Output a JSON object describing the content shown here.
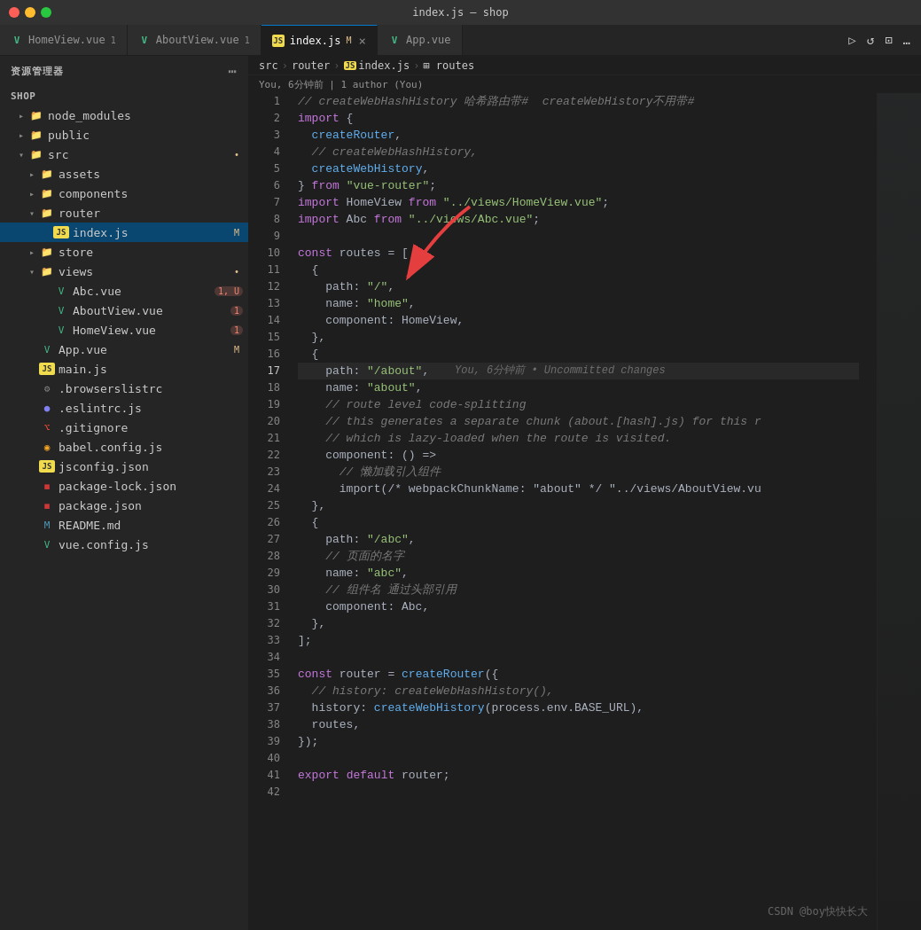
{
  "window": {
    "title": "index.js — shop"
  },
  "tabs": [
    {
      "id": "homeview",
      "label": "HomeView.vue",
      "icon": "vue",
      "badge": "1",
      "active": false
    },
    {
      "id": "aboutview",
      "label": "AboutView.vue",
      "icon": "vue",
      "badge": "1",
      "active": false
    },
    {
      "id": "indexjs",
      "label": "index.js",
      "icon": "js",
      "badge": "M",
      "active": true,
      "modified": true
    },
    {
      "id": "appvue",
      "label": "App.vue",
      "icon": "vue",
      "badge": "",
      "active": false
    }
  ],
  "sidebar": {
    "header": "资源管理器",
    "project": "SHOP",
    "items": [
      {
        "id": "node_modules",
        "label": "node_modules",
        "type": "folder",
        "indent": 1,
        "open": false
      },
      {
        "id": "public",
        "label": "public",
        "type": "folder",
        "indent": 1,
        "open": false,
        "color": "red"
      },
      {
        "id": "src",
        "label": "src",
        "type": "folder",
        "indent": 1,
        "open": true,
        "color": "red",
        "badge": "•"
      },
      {
        "id": "assets",
        "label": "assets",
        "type": "folder",
        "indent": 2,
        "open": false
      },
      {
        "id": "components",
        "label": "components",
        "type": "folder",
        "indent": 2,
        "open": false,
        "color": "red"
      },
      {
        "id": "router",
        "label": "router",
        "type": "folder",
        "indent": 2,
        "open": true,
        "color": "orange"
      },
      {
        "id": "indexjs",
        "label": "index.js",
        "type": "js",
        "indent": 3,
        "badge": "M",
        "selected": true
      },
      {
        "id": "store",
        "label": "store",
        "type": "folder",
        "indent": 2,
        "open": false,
        "color": "orange"
      },
      {
        "id": "views",
        "label": "views",
        "type": "folder",
        "indent": 2,
        "open": true,
        "color": "red",
        "badge": "•"
      },
      {
        "id": "abcvue",
        "label": "Abc.vue",
        "type": "vue",
        "indent": 3,
        "badge": "1, U"
      },
      {
        "id": "aboutviewvue",
        "label": "AboutView.vue",
        "type": "vue",
        "indent": 3,
        "badge": "1"
      },
      {
        "id": "homeviewvue",
        "label": "HomeView.vue",
        "type": "vue",
        "indent": 3,
        "badge": "1"
      },
      {
        "id": "appvue",
        "label": "App.vue",
        "type": "vue",
        "indent": 2,
        "badge": "M"
      },
      {
        "id": "mainjs",
        "label": "main.js",
        "type": "js",
        "indent": 2
      },
      {
        "id": "browserslistrc",
        "label": ".browserslistrc",
        "type": "config",
        "indent": 2
      },
      {
        "id": "eslintrc",
        "label": ".eslintrc.js",
        "type": "eslint",
        "indent": 2
      },
      {
        "id": "gitignore",
        "label": ".gitignore",
        "type": "git",
        "indent": 2
      },
      {
        "id": "babelconfig",
        "label": "babel.config.js",
        "type": "babel",
        "indent": 2
      },
      {
        "id": "jsconfigjson",
        "label": "jsconfig.json",
        "type": "js",
        "indent": 2
      },
      {
        "id": "packagelockjson",
        "label": "package-lock.json",
        "type": "npm",
        "indent": 2
      },
      {
        "id": "packagejson",
        "label": "package.json",
        "type": "npm",
        "indent": 2
      },
      {
        "id": "readme",
        "label": "README.md",
        "type": "md",
        "indent": 2
      },
      {
        "id": "vueconfig",
        "label": "vue.config.js",
        "type": "vue",
        "indent": 2
      }
    ]
  },
  "breadcrumb": {
    "parts": [
      "src",
      "router",
      "JS index.js",
      "routes"
    ]
  },
  "git_info": "You, 6分钟前 | 1 author (You)",
  "code_lines": [
    {
      "num": 1,
      "tokens": [
        {
          "t": "comment",
          "v": "// createWebHashHistory 哈希路由带#  createWebHistory不用带#"
        }
      ]
    },
    {
      "num": 2,
      "tokens": [
        {
          "t": "keyword",
          "v": "import"
        },
        {
          "t": "plain",
          "v": " {"
        }
      ]
    },
    {
      "num": 3,
      "tokens": [
        {
          "t": "plain",
          "v": "  "
        },
        {
          "t": "func",
          "v": "createRouter"
        },
        {
          "t": "plain",
          "v": ","
        }
      ]
    },
    {
      "num": 4,
      "tokens": [
        {
          "t": "comment",
          "v": "  // createWebHashHistory,"
        }
      ]
    },
    {
      "num": 5,
      "tokens": [
        {
          "t": "plain",
          "v": "  "
        },
        {
          "t": "func",
          "v": "createWebHistory"
        },
        {
          "t": "plain",
          "v": ","
        }
      ]
    },
    {
      "num": 6,
      "tokens": [
        {
          "t": "plain",
          "v": "} "
        },
        {
          "t": "keyword",
          "v": "from"
        },
        {
          "t": "plain",
          "v": " "
        },
        {
          "t": "string",
          "v": "\"vue-router\""
        },
        {
          "t": "plain",
          "v": ";"
        }
      ]
    },
    {
      "num": 7,
      "tokens": [
        {
          "t": "keyword",
          "v": "import"
        },
        {
          "t": "plain",
          "v": " HomeView "
        },
        {
          "t": "keyword",
          "v": "from"
        },
        {
          "t": "plain",
          "v": " "
        },
        {
          "t": "string",
          "v": "\"../views/HomeView.vue\""
        },
        {
          "t": "plain",
          "v": ";"
        }
      ]
    },
    {
      "num": 8,
      "tokens": [
        {
          "t": "keyword",
          "v": "import"
        },
        {
          "t": "plain",
          "v": " Abc "
        },
        {
          "t": "keyword",
          "v": "from"
        },
        {
          "t": "plain",
          "v": " "
        },
        {
          "t": "string",
          "v": "\"../views/Abc.vue\""
        },
        {
          "t": "plain",
          "v": ";"
        }
      ]
    },
    {
      "num": 9,
      "tokens": []
    },
    {
      "num": 10,
      "tokens": [
        {
          "t": "keyword",
          "v": "const"
        },
        {
          "t": "plain",
          "v": " routes = ["
        }
      ]
    },
    {
      "num": 11,
      "tokens": [
        {
          "t": "plain",
          "v": "  {"
        }
      ]
    },
    {
      "num": 12,
      "tokens": [
        {
          "t": "plain",
          "v": "    path: "
        },
        {
          "t": "string",
          "v": "\"/\""
        },
        {
          "t": "plain",
          "v": ","
        }
      ]
    },
    {
      "num": 13,
      "tokens": [
        {
          "t": "plain",
          "v": "    name: "
        },
        {
          "t": "string",
          "v": "\"home\""
        },
        {
          "t": "plain",
          "v": ","
        }
      ]
    },
    {
      "num": 14,
      "tokens": [
        {
          "t": "plain",
          "v": "    component: HomeView,"
        }
      ]
    },
    {
      "num": 15,
      "tokens": [
        {
          "t": "plain",
          "v": "  },"
        }
      ]
    },
    {
      "num": 16,
      "tokens": [
        {
          "t": "plain",
          "v": "  {"
        }
      ]
    },
    {
      "num": 17,
      "tokens": [
        {
          "t": "plain",
          "v": "    path: "
        },
        {
          "t": "string",
          "v": "\"/about\""
        },
        {
          "t": "plain",
          "v": ","
        },
        {
          "t": "gitlens",
          "v": "    You, 6分钟前 • Uncommitted changes"
        }
      ],
      "highlighted": true
    },
    {
      "num": 18,
      "tokens": [
        {
          "t": "plain",
          "v": "    name: "
        },
        {
          "t": "string",
          "v": "\"about\""
        },
        {
          "t": "plain",
          "v": ","
        }
      ]
    },
    {
      "num": 19,
      "tokens": [
        {
          "t": "comment",
          "v": "    // route level code-splitting"
        }
      ]
    },
    {
      "num": 20,
      "tokens": [
        {
          "t": "comment",
          "v": "    // this generates a separate chunk (about.[hash].js) for this r"
        }
      ]
    },
    {
      "num": 21,
      "tokens": [
        {
          "t": "comment",
          "v": "    // which is lazy-loaded when the route is visited."
        }
      ]
    },
    {
      "num": 22,
      "tokens": [
        {
          "t": "plain",
          "v": "    component: () =>"
        }
      ]
    },
    {
      "num": 23,
      "tokens": [
        {
          "t": "comment",
          "v": "      // 懒加载引入组件"
        }
      ]
    },
    {
      "num": 24,
      "tokens": [
        {
          "t": "plain",
          "v": "      import(/* webpackChunkName: \"about\" */ \"../views/AboutView.vu"
        }
      ]
    },
    {
      "num": 25,
      "tokens": [
        {
          "t": "plain",
          "v": "  },"
        }
      ]
    },
    {
      "num": 26,
      "tokens": [
        {
          "t": "plain",
          "v": "  {"
        }
      ]
    },
    {
      "num": 27,
      "tokens": [
        {
          "t": "plain",
          "v": "    path: "
        },
        {
          "t": "string",
          "v": "\"/abc\""
        },
        {
          "t": "plain",
          "v": ","
        }
      ]
    },
    {
      "num": 28,
      "tokens": [
        {
          "t": "comment",
          "v": "    // 页面的名字"
        }
      ]
    },
    {
      "num": 29,
      "tokens": [
        {
          "t": "plain",
          "v": "    name: "
        },
        {
          "t": "string",
          "v": "\"abc\""
        },
        {
          "t": "plain",
          "v": ","
        }
      ]
    },
    {
      "num": 30,
      "tokens": [
        {
          "t": "comment",
          "v": "    // 组件名 通过头部引用"
        }
      ]
    },
    {
      "num": 31,
      "tokens": [
        {
          "t": "plain",
          "v": "    component: Abc,"
        }
      ]
    },
    {
      "num": 32,
      "tokens": [
        {
          "t": "plain",
          "v": "  },"
        }
      ]
    },
    {
      "num": 33,
      "tokens": [
        {
          "t": "plain",
          "v": "];"
        }
      ]
    },
    {
      "num": 34,
      "tokens": []
    },
    {
      "num": 35,
      "tokens": [
        {
          "t": "keyword",
          "v": "const"
        },
        {
          "t": "plain",
          "v": " router = "
        },
        {
          "t": "func",
          "v": "createRouter"
        },
        {
          "t": "plain",
          "v": "({"
        }
      ]
    },
    {
      "num": 36,
      "tokens": [
        {
          "t": "comment",
          "v": "  // history: createWebHashHistory(),"
        }
      ]
    },
    {
      "num": 37,
      "tokens": [
        {
          "t": "plain",
          "v": "  history: "
        },
        {
          "t": "func",
          "v": "createWebHistory"
        },
        {
          "t": "plain",
          "v": "(process.env.BASE_URL),"
        }
      ]
    },
    {
      "num": 38,
      "tokens": [
        {
          "t": "plain",
          "v": "  routes,"
        }
      ]
    },
    {
      "num": 39,
      "tokens": [
        {
          "t": "plain",
          "v": "});"
        }
      ]
    },
    {
      "num": 40,
      "tokens": []
    },
    {
      "num": 41,
      "tokens": [
        {
          "t": "keyword",
          "v": "export"
        },
        {
          "t": "plain",
          "v": " "
        },
        {
          "t": "keyword",
          "v": "default"
        },
        {
          "t": "plain",
          "v": " router;"
        }
      ]
    },
    {
      "num": 42,
      "tokens": []
    }
  ],
  "watermark": "CSDN @boy快快长大"
}
